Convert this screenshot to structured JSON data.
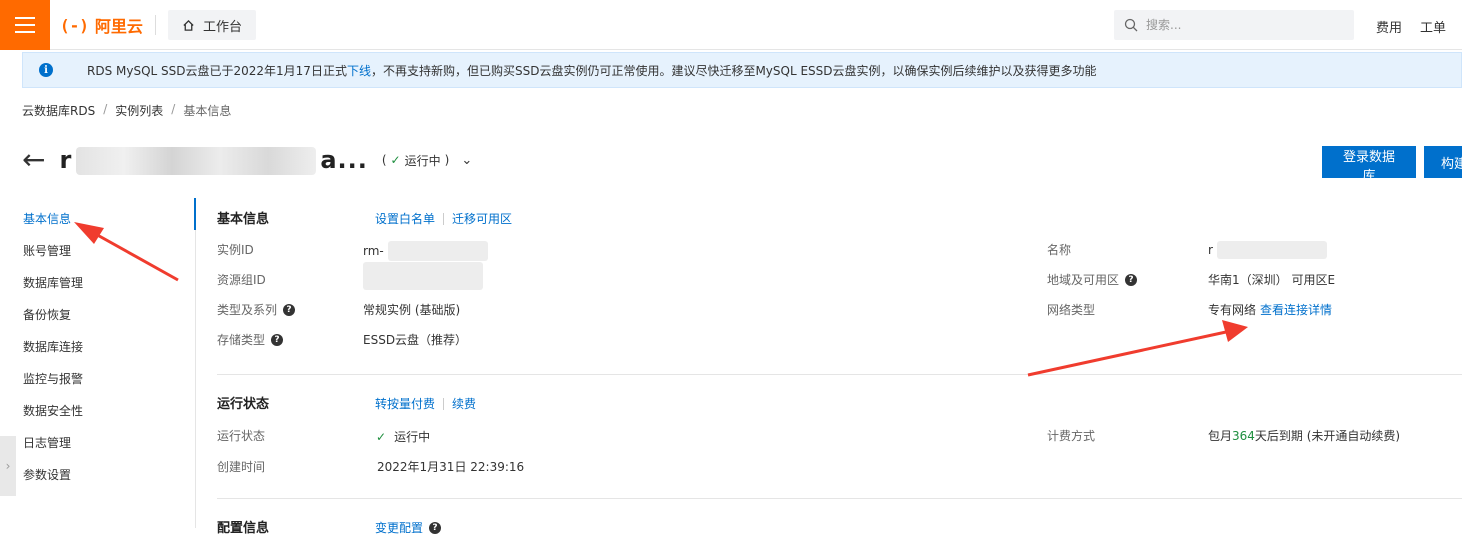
{
  "topbar": {
    "logo_mark": "(-)",
    "logo_text": "阿里云",
    "workbench": "工作台",
    "search_placeholder": "搜索...",
    "links": [
      "费用",
      "工单"
    ]
  },
  "notice": {
    "text_before": "RDS MySQL SSD云盘已于2022年1月17日正式",
    "link": "下线",
    "text_after": "，不再支持新购，但已购买SSD云盘实例仍可正常使用。建议尽快迁移至MySQL ESSD云盘实例，以确保实例后续维护以及获得更多功能"
  },
  "breadcrumb": [
    "云数据库RDS",
    "实例列表",
    "基本信息"
  ],
  "title": {
    "prefix": "r",
    "suffix": "a...",
    "status": "运行中"
  },
  "actions": {
    "login": "登录数据库",
    "build": "构建"
  },
  "sidenav": [
    "基本信息",
    "账号管理",
    "数据库管理",
    "备份恢复",
    "数据库连接",
    "监控与报警",
    "数据安全性",
    "日志管理",
    "参数设置"
  ],
  "basic": {
    "title": "基本信息",
    "link1": "设置白名单",
    "link2": "迁移可用区",
    "instance_id_label": "实例ID",
    "instance_id_value": "rm-",
    "resource_group_label": "资源组ID",
    "type_label": "类型及系列",
    "type_value": "常规实例 (基础版)",
    "storage_label": "存储类型",
    "storage_value": "ESSD云盘（推荐）",
    "name_label": "名称",
    "name_value": "r",
    "region_label": "地域及可用区",
    "region_value": "华南1（深圳） 可用区E",
    "network_label": "网络类型",
    "network_value": "专有网络",
    "network_link": "查看连接详情"
  },
  "run": {
    "title": "运行状态",
    "link1": "转按量付费",
    "link2": "续费",
    "status_label": "运行状态",
    "status_value": "运行中",
    "created_label": "创建时间",
    "created_value": "2022年1月31日 22:39:16",
    "billing_label": "计费方式",
    "billing_prefix": "包月",
    "billing_days": "364",
    "billing_suffix": "天后到期 (未开通自动续费)"
  },
  "config": {
    "title": "配置信息",
    "link1": "变更配置"
  }
}
